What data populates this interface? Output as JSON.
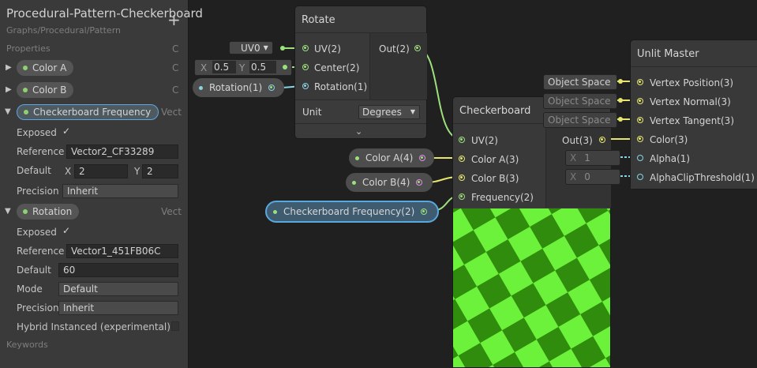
{
  "blackboard": {
    "title": "Procedural-Pattern-Checkerboard",
    "subtitle": "Graphs/Procedural/Pattern",
    "add_label": "+",
    "properties_label": "Properties",
    "properties_type": "C",
    "keywords_label": "Keywords",
    "props": [
      {
        "name": "Color A",
        "type": "C",
        "expanded": false
      },
      {
        "name": "Color B",
        "type": "C",
        "expanded": false
      },
      {
        "name": "Checkerboard Frequency",
        "type": "Vect",
        "expanded": true,
        "exposed_label": "Exposed",
        "exposed": true,
        "reference_label": "Reference",
        "reference": "Vector2_CF33289",
        "default_label": "Default",
        "default_x_label": "X",
        "default_x": "2",
        "default_y_label": "Y",
        "default_y": "2",
        "precision_label": "Precision",
        "precision": "Inherit"
      },
      {
        "name": "Rotation",
        "type": "Vect",
        "expanded": true,
        "exposed_label": "Exposed",
        "exposed": true,
        "reference_label": "Reference",
        "reference": "Vector1_451FB06C",
        "default_label": "Default",
        "default": "60",
        "mode_label": "Mode",
        "mode": "Default",
        "precision_label": "Precision",
        "precision": "Inherit",
        "hybrid_label": "Hybrid Instanced (experimental)"
      }
    ]
  },
  "rotate_node": {
    "title": "Rotate",
    "inputs": [
      "UV(2)",
      "Center(2)",
      "Rotation(1)"
    ],
    "output": "Out(2)",
    "unit_label": "Unit",
    "unit_value": "Degrees",
    "uv_value": "UV0",
    "center_x_label": "X",
    "center_x": "0.5",
    "center_y_label": "Y",
    "center_y": "0.5",
    "rotation_prop": "Rotation(1)"
  },
  "checker_node": {
    "title": "Checkerboard",
    "inputs": [
      "UV(2)",
      "Color A(3)",
      "Color B(3)",
      "Frequency(2)"
    ],
    "output": "Out(3)",
    "color_a_prop": "Color A(4)",
    "color_b_prop": "Color B(4)",
    "freq_prop": "Checkerboard Frequency(2)",
    "preview_colors": {
      "a": "#6cf23a",
      "b": "#2f8c0c"
    }
  },
  "master_node": {
    "title": "Unlit Master",
    "inputs": [
      "Vertex Position(3)",
      "Vertex Normal(3)",
      "Vertex Tangent(3)",
      "Color(3)",
      "Alpha(1)",
      "AlphaClipThreshold(1)"
    ],
    "space_chips": [
      "Object Space",
      "Object Space",
      "Object Space"
    ],
    "alpha_x_label": "X",
    "alpha_value": "1",
    "clip_x_label": "X",
    "clip_value": "0"
  },
  "colors": {
    "vector2": "#9ce07c",
    "vector3": "#e6e56e",
    "vector1": "#86d4e4",
    "color": "#e58ce3",
    "selection": "#58a7dd"
  }
}
